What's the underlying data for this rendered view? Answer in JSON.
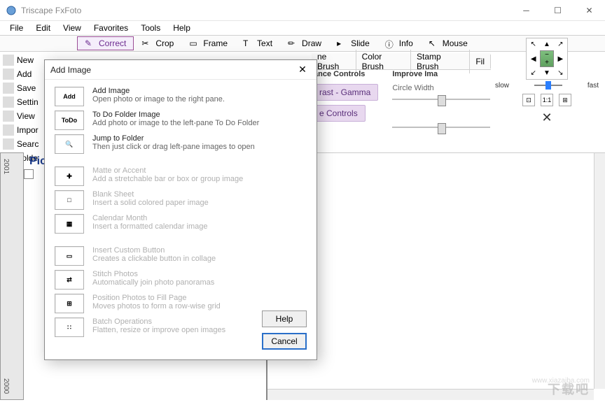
{
  "app": {
    "title": "Triscape FxFoto"
  },
  "menu": [
    "File",
    "Edit",
    "View",
    "Favorites",
    "Tools",
    "Help"
  ],
  "toolbar": [
    {
      "label": "Correct",
      "active": true
    },
    {
      "label": "Crop",
      "active": false
    },
    {
      "label": "Frame",
      "active": false
    },
    {
      "label": "Text",
      "active": false
    },
    {
      "label": "Draw",
      "active": false
    },
    {
      "label": "Slide",
      "active": false
    },
    {
      "label": "Info",
      "active": false
    },
    {
      "label": "Mouse",
      "active": false
    }
  ],
  "subtoolbar": [
    "ne Brush",
    "Color Brush",
    "Stamp Brush",
    "Fil"
  ],
  "panels": {
    "balance": {
      "title": "lance Controls",
      "btn1": "rast - Gamma",
      "btn2": "e Controls"
    },
    "improve": {
      "title": "Improve Ima",
      "slider1_label": "Circle Width"
    }
  },
  "speed": {
    "slow": "slow",
    "fast": "fast",
    "ratio": "1:1"
  },
  "sidebar": [
    {
      "label": "New"
    },
    {
      "label": "Add"
    },
    {
      "label": "Save"
    },
    {
      "label": "Settin"
    },
    {
      "label": "View"
    },
    {
      "label": "Impor"
    },
    {
      "label": "Searc"
    },
    {
      "label": "Folde"
    }
  ],
  "leftpane": {
    "year_top": "2001",
    "year_bot": "2000",
    "tab": "Pict"
  },
  "dialog": {
    "title": "Add Image",
    "items": [
      {
        "enabled": true,
        "icon": "Add",
        "title": "Add Image",
        "desc": "Open photo or image to the right pane."
      },
      {
        "enabled": true,
        "icon": "ToDo",
        "title": "To Do Folder Image",
        "desc": "Add photo or image to the left-pane To Do Folder"
      },
      {
        "enabled": true,
        "icon": "🔍",
        "title": "Jump to Folder",
        "desc": "Then just click or drag left-pane images to open"
      },
      {
        "gap": true
      },
      {
        "enabled": false,
        "icon": "✚",
        "title": "Matte or Accent",
        "desc": "Add a stretchable bar or box or group image"
      },
      {
        "enabled": false,
        "icon": "□",
        "title": "Blank Sheet",
        "desc": "Insert a solid colored paper image"
      },
      {
        "enabled": false,
        "icon": "▦",
        "title": "Calendar Month",
        "desc": "Insert a formatted calendar image"
      },
      {
        "gap": true
      },
      {
        "enabled": false,
        "icon": "▭",
        "title": "Insert Custom Button",
        "desc": "Creates a clickable button in collage"
      },
      {
        "enabled": false,
        "icon": "⇄",
        "title": "Stitch Photos",
        "desc": "Automatically join photo panoramas"
      },
      {
        "enabled": false,
        "icon": "⊞",
        "title": "Position Photos to Fill Page",
        "desc": "Moves photos to form a row-wise grid"
      },
      {
        "enabled": false,
        "icon": "∷",
        "title": "Batch Operations",
        "desc": "Flatten, resize or improve open images"
      }
    ],
    "help": "Help",
    "cancel": "Cancel"
  },
  "watermark": "下载吧"
}
